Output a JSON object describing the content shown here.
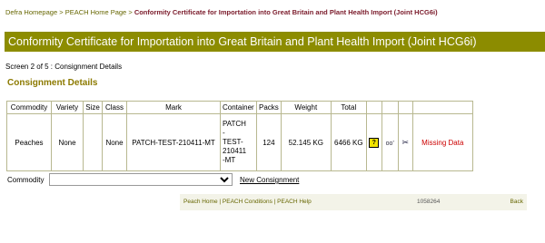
{
  "breadcrumb": {
    "items": [
      "Defra Homepage",
      "PEACH Home Page"
    ],
    "separator": ">",
    "current": "Conformity Certificate for Importation into Great Britain and Plant Health Import (Joint HCG6i)"
  },
  "page_title": "Conformity Certificate for Importation into Great Britain and Plant Health Import (Joint HCG6i)",
  "screen_label": "Screen 2 of 5 : Consignment Details",
  "section_title": "Consignment Details",
  "table": {
    "headers": [
      "Commodity",
      "Variety",
      "Size",
      "Class",
      "Mark",
      "Container",
      "Packs",
      "Weight",
      "Total"
    ],
    "rows": [
      {
        "commodity": "Peaches",
        "variety": "None",
        "size": "",
        "class": "None",
        "mark": "PATCH-TEST-210411-MT",
        "container_lines": [
          "PATCH",
          "-",
          "TEST-",
          "210411",
          "-MT"
        ],
        "packs": "124",
        "weight": "52.145  KG",
        "total": "6466  KG",
        "help_icon": "?",
        "view_icon": "glasses-icon",
        "delete_icon": "scissors-icon",
        "status": "Missing Data"
      }
    ]
  },
  "commodity_selector": {
    "label": "Commodity",
    "selected": ""
  },
  "new_consignment_label": "New Consignment",
  "footer": {
    "links": [
      "Peach Home",
      "PEACH Conditions",
      "PEACH Help"
    ],
    "separator": "|",
    "reference": "1058264",
    "back_label": "Back"
  },
  "colors": {
    "title_bar": "#8c8c00",
    "link": "#666600",
    "breadcrumb_current": "#7a1a2a",
    "section_title": "#8c7a00",
    "missing": "#cc0000",
    "table_border": "#b8b890"
  }
}
